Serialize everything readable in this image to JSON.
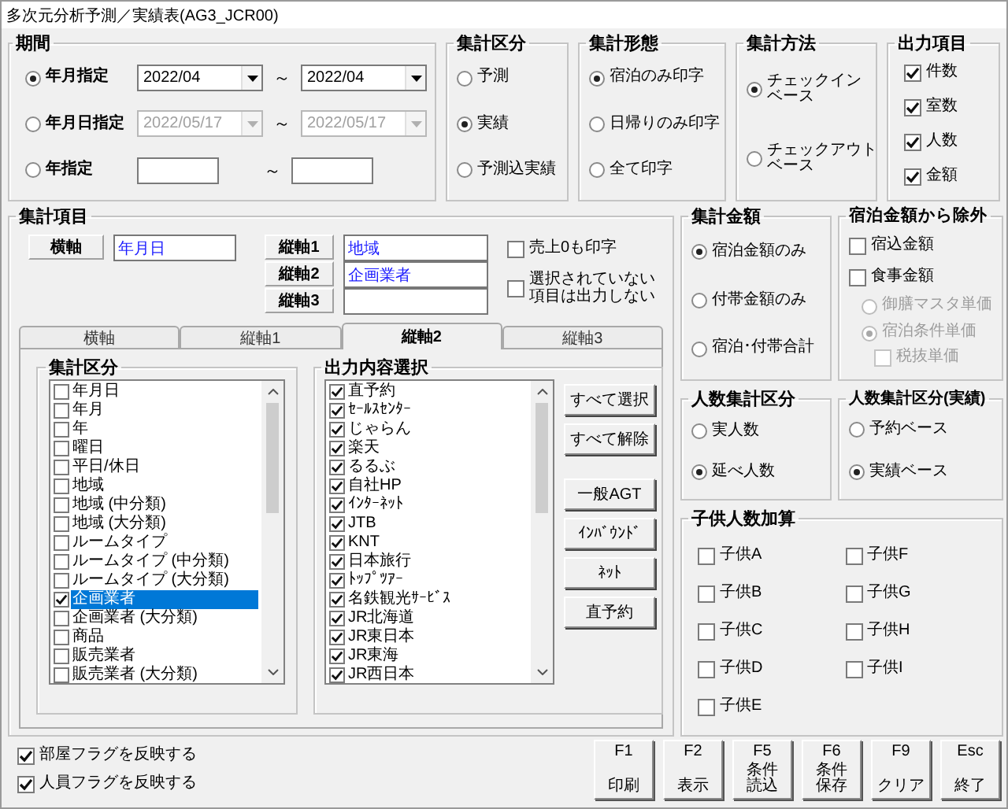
{
  "window": {
    "title": "多次元分析予測／実績表(AG3_JCR00)"
  },
  "period": {
    "title": "期間",
    "rows": [
      {
        "label": "年月指定",
        "selected": true,
        "kind": "combo",
        "disabled": false,
        "from": "2022/04",
        "separator": "～",
        "to": "2022/04"
      },
      {
        "label": "年月日指定",
        "selected": false,
        "kind": "combo",
        "disabled": true,
        "from": "2022/05/17",
        "separator": "～",
        "to": "2022/05/17"
      },
      {
        "label": "年指定",
        "selected": false,
        "kind": "text",
        "disabled": false,
        "separator": "～"
      }
    ]
  },
  "aggregation_type": {
    "title": "集計区分",
    "options": [
      {
        "label": "予測",
        "selected": false
      },
      {
        "label": "実績",
        "selected": true
      },
      {
        "label": "予測込実績",
        "selected": false
      }
    ]
  },
  "print_format": {
    "title": "集計形態",
    "options": [
      {
        "label": "宿泊のみ印字",
        "selected": true
      },
      {
        "label": "日帰りのみ印字",
        "selected": false
      },
      {
        "label": "全て印字",
        "selected": false
      }
    ]
  },
  "method": {
    "title": "集計方法",
    "options": [
      {
        "lines": [
          "チェックイン",
          "ベース"
        ],
        "selected": true
      },
      {
        "lines": [
          "チェックアウト",
          "ベース"
        ],
        "selected": false
      }
    ]
  },
  "output_items": {
    "title": "出力項目",
    "items": [
      {
        "label": "件数",
        "checked": true
      },
      {
        "label": "室数",
        "checked": true
      },
      {
        "label": "人数",
        "checked": true
      },
      {
        "label": "金額",
        "checked": true
      }
    ]
  },
  "axes": {
    "title": "集計項目",
    "horizontal": {
      "label": "横軸",
      "value": "年月日"
    },
    "vertical": [
      {
        "label": "縦軸1",
        "value": "地域"
      },
      {
        "label": "縦軸2",
        "value": "企画業者"
      },
      {
        "label": "縦軸3"
      }
    ],
    "options": [
      {
        "label": "売上0も印字",
        "checked": false
      },
      {
        "lines": [
          "選択されていない",
          "項目は出力しない"
        ],
        "checked": false
      }
    ],
    "tabs": [
      {
        "label": "横軸",
        "selected": false
      },
      {
        "label": "縦軸1",
        "selected": false
      },
      {
        "label": "縦軸2",
        "selected": true
      },
      {
        "label": "縦軸3",
        "selected": false
      }
    ],
    "category_list": {
      "title": "集計区分",
      "items": [
        {
          "label": "年月日",
          "checked": false,
          "selected": false
        },
        {
          "label": "年月",
          "checked": false,
          "selected": false
        },
        {
          "label": "年",
          "checked": false,
          "selected": false
        },
        {
          "label": "曜日",
          "checked": false,
          "selected": false
        },
        {
          "label": "平日/休日",
          "checked": false,
          "selected": false
        },
        {
          "label": "地域",
          "checked": false,
          "selected": false
        },
        {
          "label": "地域 (中分類)",
          "checked": false,
          "selected": false
        },
        {
          "label": "地域 (大分類)",
          "checked": false,
          "selected": false
        },
        {
          "label": "ルームタイプ",
          "checked": false,
          "selected": false
        },
        {
          "label": "ルームタイプ (中分類)",
          "checked": false,
          "selected": false
        },
        {
          "label": "ルームタイプ (大分類)",
          "checked": false,
          "selected": false
        },
        {
          "label": "企画業者",
          "checked": true,
          "selected": true
        },
        {
          "label": "企画業者 (大分類)",
          "checked": false,
          "selected": false
        },
        {
          "label": "商品",
          "checked": false,
          "selected": false
        },
        {
          "label": "販売業者",
          "checked": false,
          "selected": false
        },
        {
          "label": "販売業者 (大分類)",
          "checked": false,
          "selected": false
        }
      ]
    },
    "content_list": {
      "title": "出力内容選択",
      "items": [
        {
          "label": "直予約",
          "checked": true,
          "selected": false
        },
        {
          "label": "ｾｰﾙｽｾﾝﾀｰ",
          "checked": true,
          "selected": false
        },
        {
          "label": "じゃらん",
          "checked": true,
          "selected": false
        },
        {
          "label": "楽天",
          "checked": true,
          "selected": false
        },
        {
          "label": "るるぶ",
          "checked": true,
          "selected": false
        },
        {
          "label": "自社HP",
          "checked": true,
          "selected": false
        },
        {
          "label": "ｲﾝﾀｰﾈｯﾄ",
          "checked": true,
          "selected": false
        },
        {
          "label": "JTB",
          "checked": true,
          "selected": false
        },
        {
          "label": "KNT",
          "checked": true,
          "selected": false
        },
        {
          "label": "日本旅行",
          "checked": true,
          "selected": false
        },
        {
          "label": "ﾄｯﾌﾟﾂｱｰ",
          "checked": true,
          "selected": false
        },
        {
          "label": "名鉄観光ｻｰﾋﾞｽ",
          "checked": true,
          "selected": false
        },
        {
          "label": "JR北海道",
          "checked": true,
          "selected": false
        },
        {
          "label": "JR東日本",
          "checked": true,
          "selected": false
        },
        {
          "label": "JR東海",
          "checked": true,
          "selected": false
        },
        {
          "label": "JR西日本",
          "checked": true,
          "selected": false
        }
      ]
    },
    "buttons": [
      {
        "label": "すべて選択",
        "kind": "bulk"
      },
      {
        "label": "すべて解除",
        "kind": "bulk"
      },
      {
        "label": "一般AGT",
        "kind": "preset"
      },
      {
        "label": "ｲﾝﾊﾞｳﾝﾄﾞ",
        "kind": "preset"
      },
      {
        "label": "ﾈｯﾄ",
        "kind": "preset"
      },
      {
        "label": "直予約",
        "kind": "preset"
      }
    ]
  },
  "amount": {
    "title": "集計金額",
    "options": [
      {
        "label": "宿泊金額のみ",
        "selected": true
      },
      {
        "label": "付帯金額のみ",
        "selected": false
      },
      {
        "label": "宿泊･付帯合計",
        "selected": false
      }
    ]
  },
  "exclude": {
    "title": "宿泊金額から除外",
    "items": [
      {
        "kind": "checkbox",
        "label": "宿込金額",
        "checked": false,
        "disabled": false
      },
      {
        "kind": "checkbox",
        "label": "食事金額",
        "checked": false,
        "disabled": false,
        "children": [
          {
            "kind": "radio",
            "label": "御膳マスタ単価",
            "selected": false,
            "disabled": true
          },
          {
            "kind": "radio",
            "label": "宿泊条件単価",
            "selected": true,
            "disabled": true,
            "children": [
              {
                "kind": "checkbox",
                "label": "税抜単価",
                "checked": false,
                "disabled": true
              }
            ]
          }
        ]
      }
    ]
  },
  "people_count": {
    "title": "人数集計区分",
    "options": [
      {
        "label": "実人数",
        "selected": false
      },
      {
        "label": "延べ人数",
        "selected": true
      }
    ]
  },
  "people_count_actual": {
    "title": "人数集計区分(実績)",
    "options": [
      {
        "label": "予約ベース",
        "selected": false
      },
      {
        "label": "実績ベース",
        "selected": true
      }
    ]
  },
  "children_count": {
    "title": "子供人数加算",
    "items": [
      {
        "label": "子供A",
        "checked": false
      },
      {
        "label": "子供B",
        "checked": false
      },
      {
        "label": "子供C",
        "checked": false
      },
      {
        "label": "子供D",
        "checked": false
      },
      {
        "label": "子供E",
        "checked": false
      },
      {
        "label": "子供F",
        "checked": false
      },
      {
        "label": "子供G",
        "checked": false
      },
      {
        "label": "子供H",
        "checked": false
      },
      {
        "label": "子供I",
        "checked": false
      }
    ]
  },
  "flags": [
    {
      "label": "部屋フラグを反映する",
      "checked": true
    },
    {
      "label": "人員フラグを反映する",
      "checked": true
    }
  ],
  "function_keys": [
    {
      "key": "F1",
      "label": "印刷"
    },
    {
      "key": "F2",
      "label": "表示"
    },
    {
      "key": "F5",
      "lines": [
        "条件",
        "読込"
      ]
    },
    {
      "key": "F6",
      "lines": [
        "条件",
        "保存"
      ]
    },
    {
      "key": "F9",
      "label": "クリア"
    },
    {
      "key": "Esc",
      "label": "終了"
    }
  ]
}
